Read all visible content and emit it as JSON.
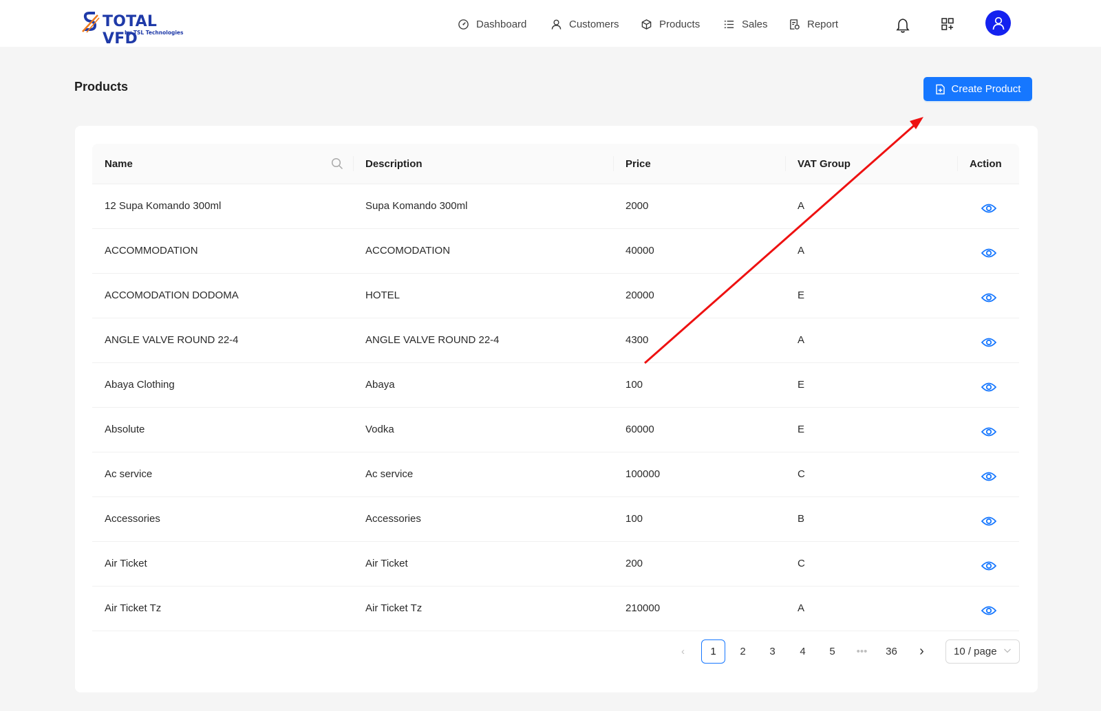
{
  "app": {
    "logo_text": "TOTAL VFD",
    "logo_sub": "by TSL Technologies"
  },
  "nav": {
    "items": [
      {
        "label": "Dashboard",
        "icon": "dashboard-icon"
      },
      {
        "label": "Customers",
        "icon": "user-icon"
      },
      {
        "label": "Products",
        "icon": "box-icon"
      },
      {
        "label": "Sales",
        "icon": "list-icon"
      },
      {
        "label": "Report",
        "icon": "report-icon"
      }
    ],
    "right_icons": [
      "bell-icon",
      "apps-icon",
      "avatar-user-icon"
    ]
  },
  "page": {
    "title": "Products",
    "create_button": "Create Product"
  },
  "table": {
    "columns": [
      "Name",
      "Description",
      "Price",
      "VAT Group",
      "Action"
    ],
    "rows": [
      {
        "name": "12 Supa Komando 300ml",
        "description": "Supa Komando 300ml",
        "price": "2000",
        "vat": "A"
      },
      {
        "name": "ACCOMMODATION",
        "description": "ACCOMODATION",
        "price": "40000",
        "vat": "A"
      },
      {
        "name": "ACCOMODATION DODOMA",
        "description": "HOTEL",
        "price": "20000",
        "vat": "E"
      },
      {
        "name": "ANGLE VALVE ROUND 22-4",
        "description": "ANGLE VALVE ROUND 22-4",
        "price": "4300",
        "vat": "A"
      },
      {
        "name": "Abaya Clothing",
        "description": "Abaya",
        "price": "100",
        "vat": "E"
      },
      {
        "name": "Absolute",
        "description": "Vodka",
        "price": "60000",
        "vat": "E"
      },
      {
        "name": "Ac service",
        "description": "Ac service",
        "price": "100000",
        "vat": "C"
      },
      {
        "name": "Accessories",
        "description": "Accessories",
        "price": "100",
        "vat": "B"
      },
      {
        "name": "Air Ticket",
        "description": "Air Ticket",
        "price": "200",
        "vat": "C"
      },
      {
        "name": "Air Ticket Tz",
        "description": "Air Ticket Tz",
        "price": "210000",
        "vat": "A"
      }
    ]
  },
  "pagination": {
    "pages": [
      "1",
      "2",
      "3",
      "4",
      "5",
      "•••",
      "36"
    ],
    "current": "1",
    "prev": "‹",
    "next": "›",
    "page_size": "10 / page"
  },
  "colors": {
    "primary": "#1677ff",
    "avatar": "#1422ef",
    "annotation_arrow": "#ee1111"
  }
}
